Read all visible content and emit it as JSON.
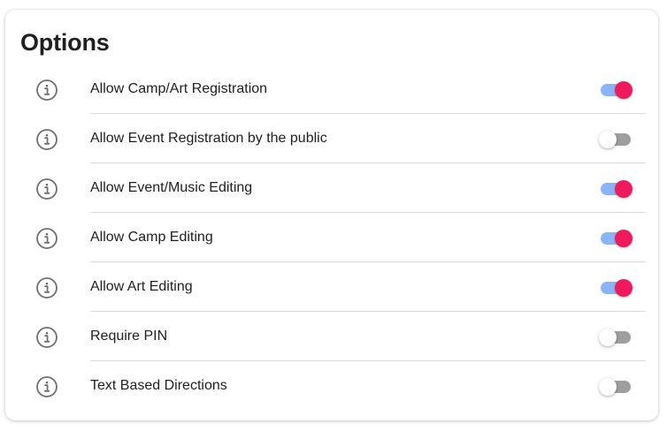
{
  "card": {
    "title": "Options"
  },
  "colors": {
    "toggle_on_thumb": "#f0195c",
    "toggle_on_track": "#8ab4f8",
    "toggle_off_thumb": "#ffffff",
    "toggle_off_track": "#9e9e9e",
    "icon": "#6f6f6f"
  },
  "options": [
    {
      "label": "Allow Camp/Art Registration",
      "enabled": true,
      "icon": "info-icon"
    },
    {
      "label": "Allow Event Registration by the public",
      "enabled": false,
      "icon": "info-icon"
    },
    {
      "label": "Allow Event/Music Editing",
      "enabled": true,
      "icon": "info-icon"
    },
    {
      "label": "Allow Camp Editing",
      "enabled": true,
      "icon": "info-icon"
    },
    {
      "label": "Allow Art Editing",
      "enabled": true,
      "icon": "info-icon"
    },
    {
      "label": "Require PIN",
      "enabled": false,
      "icon": "info-icon"
    },
    {
      "label": "Text Based Directions",
      "enabled": false,
      "icon": "info-icon"
    }
  ]
}
